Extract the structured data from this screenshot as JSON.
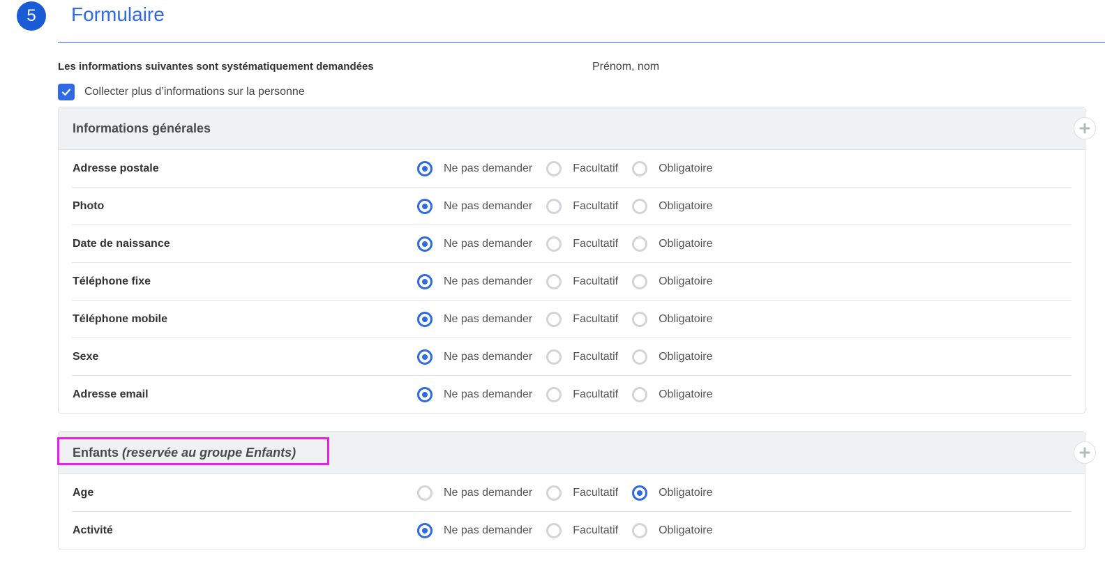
{
  "step": {
    "number": "5",
    "title": "Formulaire"
  },
  "info": {
    "label": "Les informations suivantes sont systématiquement demandées",
    "value": "Prénom, nom"
  },
  "collect": {
    "label": "Collecter plus d’informations sur la personne",
    "checked": true
  },
  "options": [
    "Ne pas demander",
    "Facultatif",
    "Obligatoire"
  ],
  "colors": {
    "accent": "#2f6ae3",
    "highlight": "#e51ee8"
  },
  "sections": [
    {
      "title": "Informations générales",
      "hint": "",
      "rows": [
        {
          "label": "Adresse postale",
          "selected": 0
        },
        {
          "label": "Photo",
          "selected": 0
        },
        {
          "label": "Date de naissance",
          "selected": 0
        },
        {
          "label": "Téléphone fixe",
          "selected": 0
        },
        {
          "label": "Téléphone mobile",
          "selected": 0
        },
        {
          "label": "Sexe",
          "selected": 0
        },
        {
          "label": "Adresse email",
          "selected": 0
        }
      ]
    },
    {
      "title": "Enfants",
      "hint": "(reservée au groupe Enfants)",
      "rows": [
        {
          "label": "Age",
          "selected": 2
        },
        {
          "label": "Activité",
          "selected": 0
        }
      ]
    }
  ]
}
